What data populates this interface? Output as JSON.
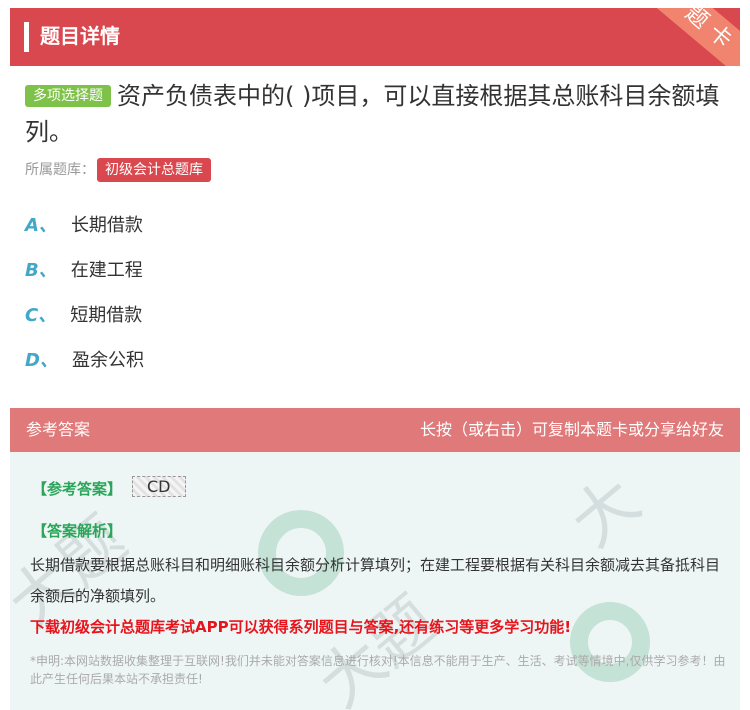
{
  "header": {
    "title": "题目详情",
    "corner_label": "题卡"
  },
  "question": {
    "type_badge": "多项选择题",
    "text": "资产负债表中的( )项目，可以直接根据其总账科目余额填列。",
    "bank_label": "所属题库：",
    "bank_name": "初级会计总题库"
  },
  "options": [
    {
      "letter": "A、",
      "text": "长期借款"
    },
    {
      "letter": "B、",
      "text": "在建工程"
    },
    {
      "letter": "C、",
      "text": "短期借款"
    },
    {
      "letter": "D、",
      "text": "盈余公积"
    }
  ],
  "answer_panel": {
    "title": "参考答案",
    "hint": "长按（或右击）可复制本题卡或分享给好友",
    "ref_label": "【参考答案】",
    "ref_value": "CD",
    "analysis_label": "【答案解析】",
    "analysis_text": "长期借款要根据总账科目和明细账科目余额分析计算填列；在建工程要根据有关科目余额减去其备抵科目余额后的净额填列。",
    "promo": "下载初级会计总题库考试APP可以获得系列题目与答案,还有练习等更多学习功能!",
    "disclaimer": "*申明:本网站数据收集整理于互联网!我们并未能对答案信息进行核对!本信息不能用于生产、生活、考试等情境中,仅供学习参考！由此产生任何后果本站不承担责任!"
  },
  "colors": {
    "header_red": "#d9484e",
    "badge_green": "#7fc249",
    "option_letter": "#43a8c8",
    "promo_red": "#e8141c"
  }
}
